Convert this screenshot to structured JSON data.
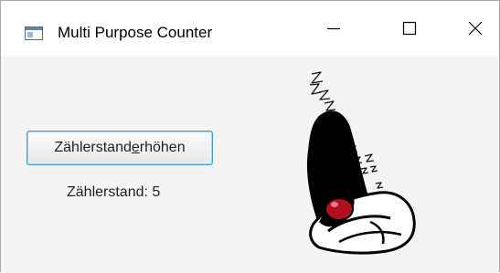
{
  "window": {
    "title": "Multi Purpose Counter",
    "controls": {
      "minimize": "minimize",
      "maximize": "maximize",
      "close": "close"
    }
  },
  "main": {
    "button": {
      "label_before": "Zählerstand ",
      "label_mnemonic": "e",
      "label_after": "rhöhen"
    },
    "counter_label": "Zählerstand: 5",
    "image_icon": "java-duke-mascot"
  },
  "colors": {
    "focus_border": "#3d9bd6",
    "duke_nose": "#b01020"
  }
}
